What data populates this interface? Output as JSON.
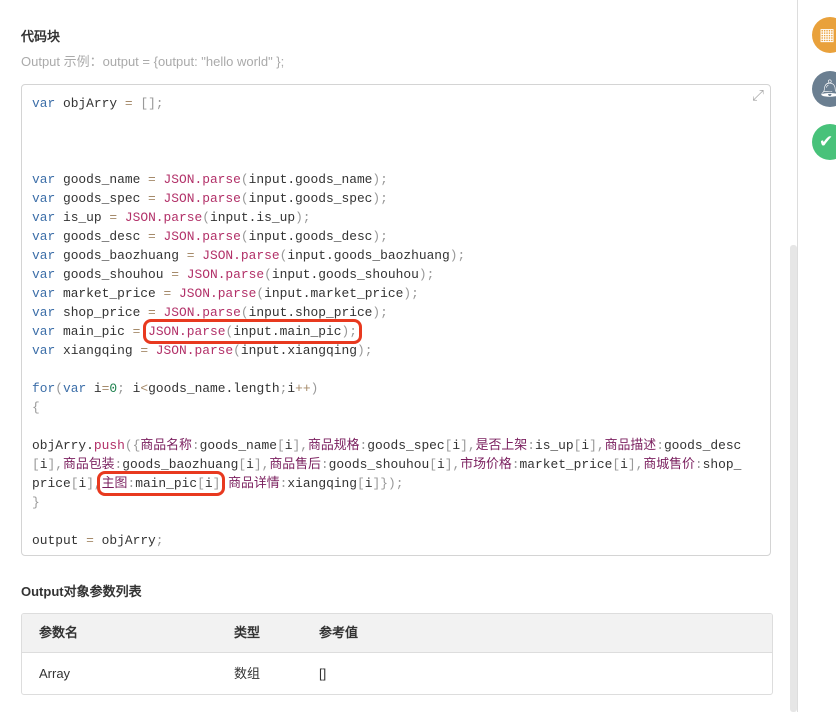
{
  "header": {
    "title": "代码块",
    "hint": "Output 示例：output = {output: \"hello world\" };"
  },
  "code_lines": [
    [
      [
        "k",
        "var"
      ],
      [
        "v",
        " objArry "
      ],
      [
        "o",
        "="
      ],
      [
        "p",
        " [];"
      ]
    ],
    [],
    [],
    [],
    [
      [
        "k",
        "var"
      ],
      [
        "v",
        " goods_name "
      ],
      [
        "o",
        "="
      ],
      [
        "f",
        " JSON.parse"
      ],
      [
        "p",
        "("
      ],
      [
        "v",
        "input.goods_name"
      ],
      [
        "p",
        ");"
      ]
    ],
    [
      [
        "k",
        "var"
      ],
      [
        "v",
        " goods_spec "
      ],
      [
        "o",
        "="
      ],
      [
        "f",
        " JSON.parse"
      ],
      [
        "p",
        "("
      ],
      [
        "v",
        "input.goods_spec"
      ],
      [
        "p",
        ");"
      ]
    ],
    [
      [
        "k",
        "var"
      ],
      [
        "v",
        " is_up "
      ],
      [
        "o",
        "="
      ],
      [
        "f",
        " JSON.parse"
      ],
      [
        "p",
        "("
      ],
      [
        "v",
        "input.is_up"
      ],
      [
        "p",
        ");"
      ]
    ],
    [
      [
        "k",
        "var"
      ],
      [
        "v",
        " goods_desc "
      ],
      [
        "o",
        "="
      ],
      [
        "f",
        " JSON.parse"
      ],
      [
        "p",
        "("
      ],
      [
        "v",
        "input.goods_desc"
      ],
      [
        "p",
        ");"
      ]
    ],
    [
      [
        "k",
        "var"
      ],
      [
        "v",
        " goods_baozhuang "
      ],
      [
        "o",
        "="
      ],
      [
        "f",
        " JSON.parse"
      ],
      [
        "p",
        "("
      ],
      [
        "v",
        "input.goods_baozhuang"
      ],
      [
        "p",
        ");"
      ]
    ],
    [
      [
        "k",
        "var"
      ],
      [
        "v",
        " goods_shouhou "
      ],
      [
        "o",
        "="
      ],
      [
        "f",
        " JSON.parse"
      ],
      [
        "p",
        "("
      ],
      [
        "v",
        "input.goods_shouhou"
      ],
      [
        "p",
        ");"
      ]
    ],
    [
      [
        "k",
        "var"
      ],
      [
        "v",
        " market_price "
      ],
      [
        "o",
        "="
      ],
      [
        "f",
        " JSON.parse"
      ],
      [
        "p",
        "("
      ],
      [
        "v",
        "input.market_price"
      ],
      [
        "p",
        ");"
      ]
    ],
    [
      [
        "k",
        "var"
      ],
      [
        "v",
        " shop_price "
      ],
      [
        "o",
        "="
      ],
      [
        "f",
        " JSON.parse"
      ],
      [
        "p",
        "("
      ],
      [
        "v",
        "input.shop_price"
      ],
      [
        "p",
        ");"
      ]
    ],
    [
      [
        "k",
        "var"
      ],
      [
        "v",
        " main_pic "
      ],
      [
        "o",
        "="
      ],
      [
        "v",
        " "
      ],
      [
        "f",
        "JSON.parse",
        1
      ],
      [
        "p",
        "(",
        1
      ],
      [
        "v",
        "input.main_pic",
        1
      ],
      [
        "p",
        ");",
        1
      ]
    ],
    [
      [
        "k",
        "var"
      ],
      [
        "v",
        " xiangqing "
      ],
      [
        "o",
        "="
      ],
      [
        "f",
        " JSON.parse"
      ],
      [
        "p",
        "("
      ],
      [
        "v",
        "input.xiangqing"
      ],
      [
        "p",
        ");"
      ]
    ],
    [],
    [
      [
        "k",
        "for"
      ],
      [
        "p",
        "("
      ],
      [
        "k",
        "var"
      ],
      [
        "v",
        " i"
      ],
      [
        "o",
        "="
      ],
      [
        "n",
        "0"
      ],
      [
        "p",
        ";"
      ],
      [
        "v",
        " i"
      ],
      [
        "o",
        "<"
      ],
      [
        "v",
        "goods_name.length"
      ],
      [
        "p",
        ";"
      ],
      [
        "v",
        "i"
      ],
      [
        "o",
        "++"
      ],
      [
        "p",
        ")"
      ]
    ],
    [
      [
        "p",
        "{"
      ]
    ],
    [],
    [
      [
        "v",
        "objArry."
      ],
      [
        "f",
        "push"
      ],
      [
        "p",
        "({"
      ],
      [
        "s",
        "商品名称"
      ],
      [
        "p",
        ":"
      ],
      [
        "v",
        "goods_name"
      ],
      [
        "p",
        "["
      ],
      [
        "v",
        "i"
      ],
      [
        "p",
        "],"
      ],
      [
        "s",
        "商品规格"
      ],
      [
        "p",
        ":"
      ],
      [
        "v",
        "goods_spec"
      ],
      [
        "p",
        "["
      ],
      [
        "v",
        "i"
      ],
      [
        "p",
        "],"
      ],
      [
        "s",
        "是否上架"
      ],
      [
        "p",
        ":"
      ],
      [
        "v",
        "is_up"
      ],
      [
        "p",
        "["
      ],
      [
        "v",
        "i"
      ],
      [
        "p",
        "],"
      ],
      [
        "s",
        "商品描述"
      ],
      [
        "p",
        ":"
      ],
      [
        "v",
        "goods_desc"
      ],
      [
        "p",
        "["
      ],
      [
        "v",
        "i"
      ],
      [
        "p",
        "],"
      ],
      [
        "s",
        "商品包装"
      ],
      [
        "p",
        ":"
      ],
      [
        "v",
        "goods_baozhuang"
      ],
      [
        "p",
        "["
      ],
      [
        "v",
        "i"
      ],
      [
        "p",
        "],"
      ],
      [
        "s",
        "商品售后"
      ],
      [
        "p",
        ":"
      ],
      [
        "v",
        "goods_shouhou"
      ],
      [
        "p",
        "["
      ],
      [
        "v",
        "i"
      ],
      [
        "p",
        "],"
      ],
      [
        "s",
        "市场价格"
      ],
      [
        "p",
        ":"
      ],
      [
        "v",
        "market_price"
      ],
      [
        "p",
        "["
      ],
      [
        "v",
        "i"
      ],
      [
        "p",
        "],"
      ],
      [
        "s",
        "商城售价"
      ],
      [
        "p",
        ":"
      ],
      [
        "v",
        "shop_price"
      ],
      [
        "p",
        "["
      ],
      [
        "v",
        "i"
      ],
      [
        "p",
        "],"
      ],
      [
        "s",
        "主图",
        1
      ],
      [
        "p",
        ":",
        1
      ],
      [
        "v",
        "main_pic",
        1
      ],
      [
        "p",
        "[",
        1
      ],
      [
        "v",
        "i",
        1
      ],
      [
        "p",
        "]",
        1
      ],
      [
        "p",
        ","
      ],
      [
        "s",
        "商品详情"
      ],
      [
        "p",
        ":"
      ],
      [
        "v",
        "xiangqing"
      ],
      [
        "p",
        "["
      ],
      [
        "v",
        "i"
      ],
      [
        "p",
        "]});"
      ]
    ],
    [
      [
        "p",
        "}"
      ]
    ],
    [],
    [
      [
        "v",
        "output "
      ],
      [
        "o",
        "="
      ],
      [
        "v",
        " objArry"
      ],
      [
        "p",
        ";"
      ]
    ]
  ],
  "output_section": {
    "title": "Output对象参数列表",
    "columns": [
      "参数名",
      "类型",
      "参考值"
    ],
    "rows": [
      [
        "Array",
        "数组",
        "[]"
      ]
    ]
  },
  "side_icons": [
    {
      "name": "grid-icon",
      "color": "#e9a13b"
    },
    {
      "name": "bell-icon",
      "color": "#6b7f91"
    },
    {
      "name": "check-icon",
      "color": "#48c27a"
    }
  ]
}
